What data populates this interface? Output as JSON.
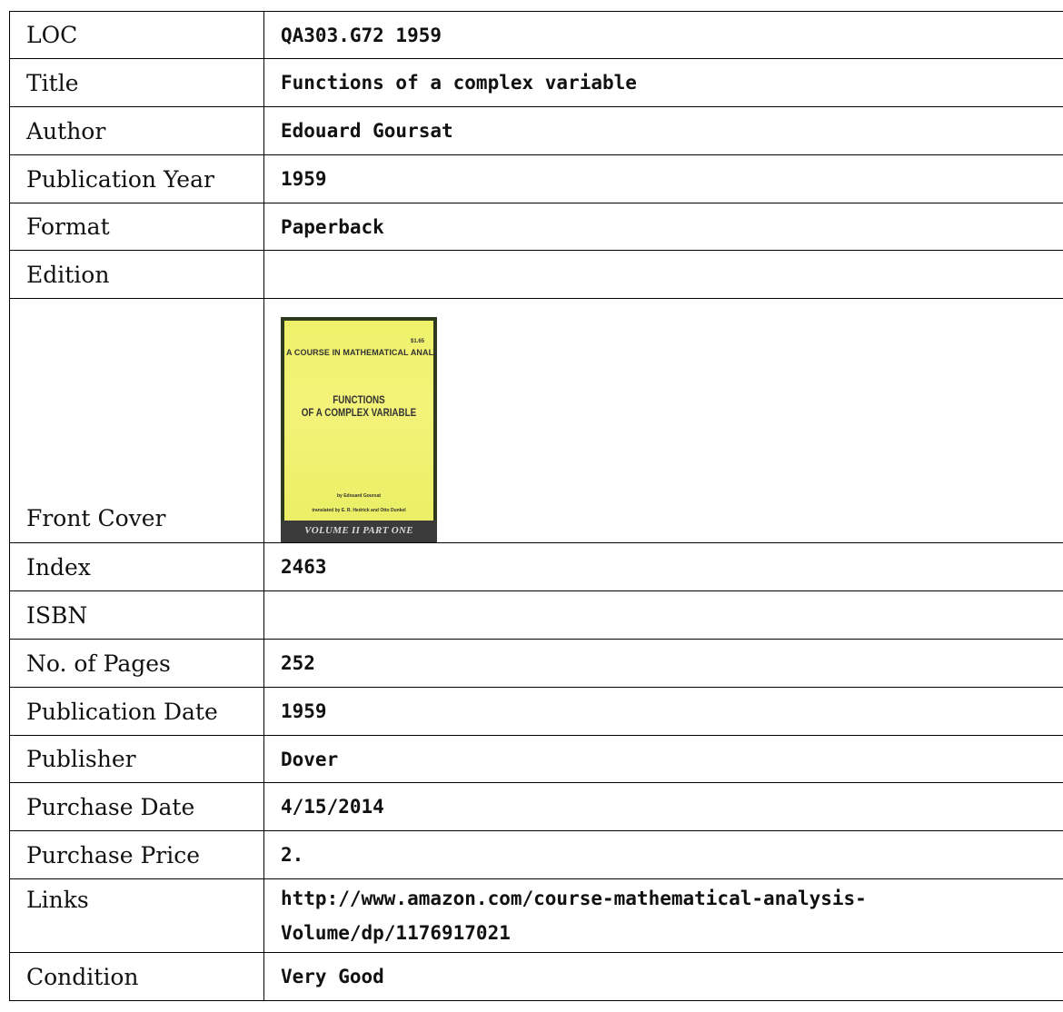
{
  "record": {
    "loc": {
      "label": "LOC",
      "value": "QA303.G72 1959"
    },
    "title": {
      "label": "Title",
      "value": "Functions of a complex variable"
    },
    "author": {
      "label": "Author",
      "value": "Edouard Goursat"
    },
    "publication_year": {
      "label": "Publication Year",
      "value": "1959"
    },
    "format": {
      "label": "Format",
      "value": "Paperback"
    },
    "edition": {
      "label": "Edition",
      "value": ""
    },
    "front_cover": {
      "label": "Front Cover",
      "image": {
        "price": "$1.65",
        "series": "A COURSE IN MATHEMATICAL ANALYSIS",
        "title_line1": "FUNCTIONS",
        "title_line2": "OF A COMPLEX VARIABLE",
        "author_line": "by Edouard Goursat",
        "translator_line": "translated by E. R. Hedrick and Otto Dunkel",
        "volume_band": "VOLUME II PART ONE",
        "colors": {
          "cover": "#e8e84a",
          "band": "#3b3b3b"
        }
      }
    },
    "index": {
      "label": "Index",
      "value": "2463"
    },
    "isbn": {
      "label": "ISBN",
      "value": ""
    },
    "pages": {
      "label": "No. of Pages",
      "value": "252"
    },
    "publication_date": {
      "label": "Publication Date",
      "value": "1959"
    },
    "publisher": {
      "label": "Publisher",
      "value": "Dover"
    },
    "purchase_date": {
      "label": "Purchase Date",
      "value": "4/15/2014"
    },
    "purchase_price": {
      "label": "Purchase Price",
      "value": "2."
    },
    "links": {
      "label": "Links",
      "value_line1": "http://www.amazon.com/course-mathematical-analysis-",
      "value_line2": "Volume/dp/1176917021"
    },
    "condition": {
      "label": "Condition",
      "value": "Very Good"
    }
  }
}
